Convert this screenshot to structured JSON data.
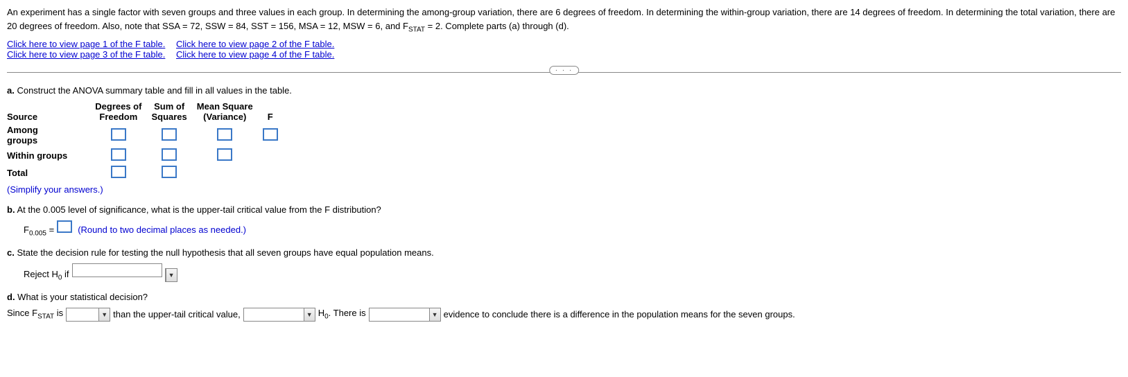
{
  "problem": {
    "line1_a": "An experiment has a single factor with seven groups and three values in each group. In determining the among-group variation, there are 6 degrees of freedom. In determining the within-group variation, there are 14 degrees of freedom. In determining the total variation, there are",
    "line2_a": "20 degrees of freedom. Also, note that SSA = 72, SSW = 84, SST = 156, MSA = 12, MSW = 6, and F",
    "line2_b": " = 2. Complete parts (a) through (d).",
    "stat_sub": "STAT"
  },
  "links": {
    "p1": "Click here to view page 1 of the F table.",
    "p2": "Click here to view page 2 of the F table.",
    "p3": "Click here to view page 3 of the F table.",
    "p4": "Click here to view page 4 of the F table."
  },
  "badge": "· · ·",
  "a": {
    "label": "a.",
    "text": " Construct the ANOVA summary table and fill in all values in the table.",
    "headers": {
      "source": "Source",
      "df": "Degrees of\nFreedom",
      "ss": "Sum of\nSquares",
      "ms": "Mean Square\n(Variance)",
      "f": "F"
    },
    "rows": {
      "among": "Among\ngroups",
      "within": "Within groups",
      "total": "Total"
    },
    "hint": "(Simplify your answers.)"
  },
  "b": {
    "label": "b.",
    "text": " At the 0.005 level of significance, what is the upper-tail critical value from the F distribution?",
    "flabel_a": "F",
    "flabel_sub": "0.005",
    "eq": " = ",
    "hint": "(Round to two decimal places as needed.)"
  },
  "c": {
    "label": "c.",
    "text": " State the decision rule for testing the null hypothesis that all seven groups have equal population means.",
    "reject_a": "Reject H",
    "reject_sub": "0",
    "reject_b": " if"
  },
  "d": {
    "label": "d.",
    "text": " What is your statistical decision?",
    "since_a": "Since F",
    "since_sub": "STAT",
    "since_b": " is",
    "than": " than the upper-tail critical value, ",
    "h0_a": " H",
    "h0_sub": "0",
    "there_is": ". There is ",
    "evidence": " evidence to conclude there is a difference in the population means for the seven groups."
  }
}
